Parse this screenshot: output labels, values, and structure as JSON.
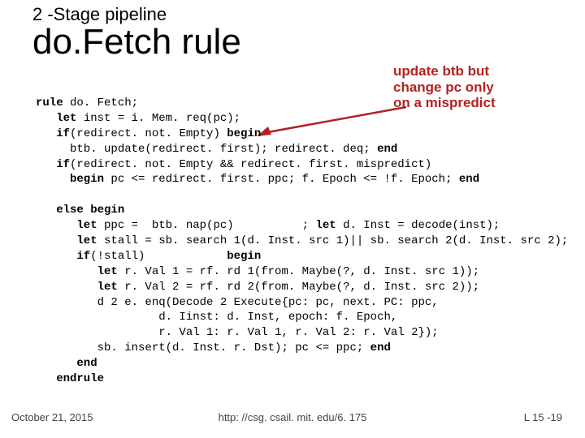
{
  "title": {
    "small": "2 -Stage pipeline",
    "large": "do.Fetch rule"
  },
  "annotation": {
    "line1": "update btb but",
    "line2": "change pc only",
    "line3": "on a mispredict"
  },
  "code": {
    "l01a": "rule",
    "l01b": " do. Fetch;",
    "l02a": "   let",
    "l02b": " inst = i. Mem. req(pc);",
    "l03a": "   if",
    "l03b": "(redirect. not. Empty) ",
    "l03c": "begin",
    "l04": "     btb. update(redirect. first); redirect. deq; ",
    "l04e": "end",
    "l05a": "   if",
    "l05b": "(redirect. not. Empty && redirect. first. mispredict)",
    "l06a": "     begin",
    "l06b": " pc <= redirect. first. ppc; f. Epoch <= !f. Epoch; ",
    "l06c": "end",
    "blank": "",
    "l08a": "   else begin",
    "l09a": "      let",
    "l09b": " ppc =  btb. nap(pc)          ; ",
    "l09c": "let",
    "l09d": " d. Inst = decode(inst);",
    "l10a": "      let",
    "l10b": " stall = sb. search 1(d. Inst. src 1)|| sb. search 2(d. Inst. src 2);",
    "l11a": "      if",
    "l11b": "(!stall)            ",
    "l11c": "begin",
    "l12a": "         let",
    "l12b": " r. Val 1 = rf. rd 1(from. Maybe(?, d. Inst. src 1));",
    "l13a": "         let",
    "l13b": " r. Val 2 = rf. rd 2(from. Maybe(?, d. Inst. src 2));",
    "l14": "         d 2 e. enq(Decode 2 Execute{pc: pc, next. PC: ppc,",
    "l15": "                  d. Iinst: d. Inst, epoch: f. Epoch,",
    "l16": "                  r. Val 1: r. Val 1, r. Val 2: r. Val 2});",
    "l17": "         sb. insert(d. Inst. r. Dst); pc <= ppc; ",
    "l17e": "end",
    "l18": "      end",
    "l19": "   endrule"
  },
  "footer": {
    "date": "October 21, 2015",
    "url": "http: //csg. csail. mit. edu/6. 175",
    "page": "L 15 -19"
  }
}
